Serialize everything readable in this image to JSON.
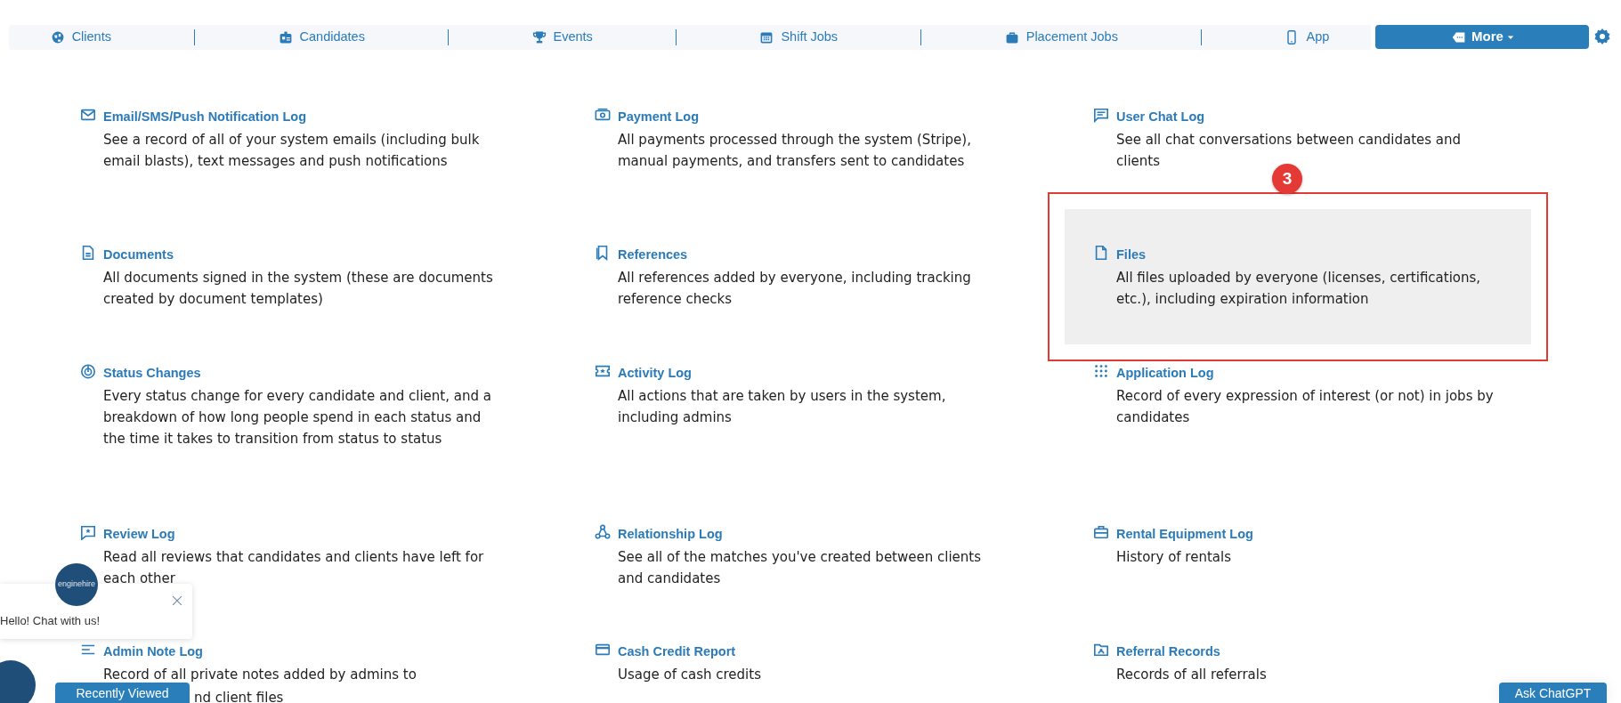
{
  "nav": {
    "items": [
      {
        "label": "Clients"
      },
      {
        "label": "Candidates"
      },
      {
        "label": "Events"
      },
      {
        "label": "Shift Jobs"
      },
      {
        "label": "Placement Jobs"
      },
      {
        "label": "App"
      }
    ],
    "more": {
      "label": "More"
    }
  },
  "logs": [
    {
      "title": "Email/SMS/Push Notification Log",
      "description": "See a record of all of your system emails (including bulk email blasts), text messages and push notifications"
    },
    {
      "title": "Payment Log",
      "description": "All payments processed through the system (Stripe), manual payments, and transfers sent to candidates"
    },
    {
      "title": "User Chat Log",
      "description": "See all chat conversations between candidates and clients"
    },
    {
      "title": "Documents",
      "description": "All documents signed in the system (these are documents created by document templates)"
    },
    {
      "title": "References",
      "description": "All references added by everyone, including tracking reference checks"
    },
    {
      "title": "Files",
      "description": "All files uploaded by everyone (licenses, certifications, etc.), including expiration information",
      "highlighted": true
    },
    {
      "title": "Status Changes",
      "description": "Every status change for every candidate and client, and a breakdown of how long people spend in each status and the time it takes to transition from status to status"
    },
    {
      "title": "Activity Log",
      "description": "All actions that are taken by users in the system, including admins"
    },
    {
      "title": "Application Log",
      "description": "Record of every expression of interest (or not) in jobs by candidates"
    },
    {
      "title": "Review Log",
      "description": "Read all reviews that candidates and clients have left for each other"
    },
    {
      "title": "Relationship Log",
      "description": "See all of the matches you've created between clients and candidates"
    },
    {
      "title": "Rental Equipment Log",
      "description": "History of rentals"
    },
    {
      "title": "Admin Note Log",
      "description": "Record of all private notes added by admins to",
      "description_cont": "nd client files"
    },
    {
      "title": "Cash Credit Report",
      "description": "Usage of cash credits"
    },
    {
      "title": "Referral Records",
      "description": "Records of all referrals"
    }
  ],
  "step_callout": "3",
  "chat_widget": {
    "logo": "enginehire",
    "message": "Hello! Chat with us!"
  },
  "recently_viewed": "Recently Viewed",
  "ask_button": "Ask ChatGPT"
}
